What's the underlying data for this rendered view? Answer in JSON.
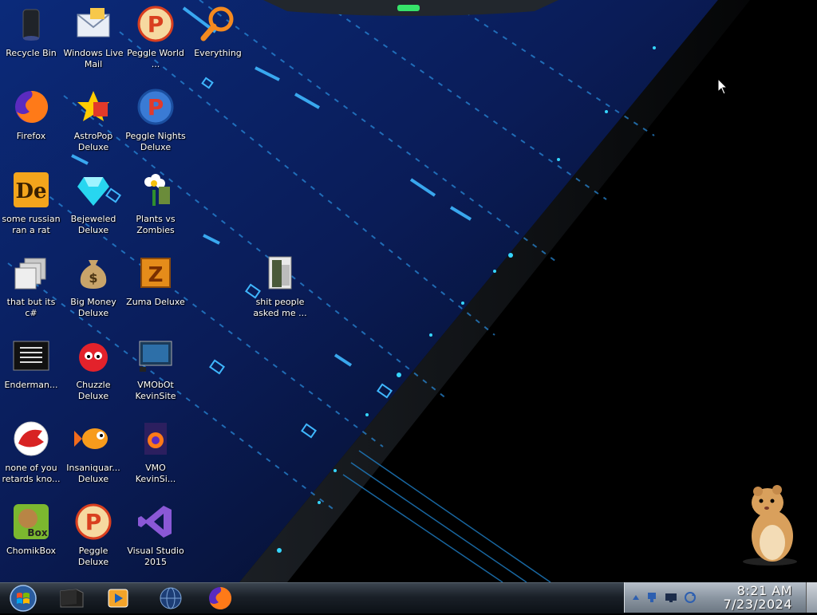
{
  "desktop": {
    "icons": [
      {
        "id": "recycle-bin",
        "label": "Recycle Bin",
        "icon": "recycle-bin-icon"
      },
      {
        "id": "windows-live-mail",
        "label": "Windows Live Mail",
        "icon": "mail-icon"
      },
      {
        "id": "peggle-world",
        "label": "Peggle World ...",
        "icon": "peggle-icon"
      },
      {
        "id": "everything",
        "label": "Everything",
        "icon": "magnifier-icon"
      },
      {
        "id": "firefox",
        "label": "Firefox",
        "icon": "firefox-icon"
      },
      {
        "id": "astropop",
        "label": "AstroPop Deluxe",
        "icon": "astropop-icon"
      },
      {
        "id": "peggle-nights",
        "label": "Peggle Nights Deluxe",
        "icon": "peggle-nights-icon"
      },
      {
        "id": "some-russian",
        "label": "some russian ran a rat",
        "icon": "de-icon"
      },
      {
        "id": "bejeweled",
        "label": "Bejeweled Deluxe",
        "icon": "gem-icon"
      },
      {
        "id": "pvz",
        "label": "Plants vs Zombies",
        "icon": "flower-icon"
      },
      {
        "id": "that-but-csharp",
        "label": "that but its c#",
        "icon": "copy-icon"
      },
      {
        "id": "big-money",
        "label": "Big Money Deluxe",
        "icon": "money-bag-icon"
      },
      {
        "id": "zuma",
        "label": "Zuma Deluxe",
        "icon": "zuma-icon"
      },
      {
        "id": "shit-people",
        "label": "shit people asked me ...",
        "icon": "folder-icon"
      },
      {
        "id": "enderman",
        "label": "Enderman...",
        "icon": "terminal-icon"
      },
      {
        "id": "chuzzle",
        "label": "Chuzzle Deluxe",
        "icon": "chuzzle-icon"
      },
      {
        "id": "vmobot",
        "label": "VMObOt KevinSite",
        "icon": "monitor-icon"
      },
      {
        "id": "none-of-you",
        "label": "none of you retards kno...",
        "icon": "red-creature-icon"
      },
      {
        "id": "insaniquarium",
        "label": "Insaniquar... Deluxe",
        "icon": "fish-icon"
      },
      {
        "id": "vmo-kevinsi",
        "label": "VMO KevinSi...",
        "icon": "firefox-file-icon"
      },
      {
        "id": "chomikbox",
        "label": "ChomikBox",
        "icon": "hamster-box-icon"
      },
      {
        "id": "peggle-deluxe",
        "label": "Peggle Deluxe",
        "icon": "peggle-icon"
      },
      {
        "id": "visual-studio",
        "label": "Visual Studio 2015",
        "icon": "visual-studio-icon"
      }
    ]
  },
  "taskbar": {
    "buttons": [
      {
        "id": "start",
        "icon": "windows-orb-icon"
      },
      {
        "id": "file-explorer",
        "icon": "folder-dark-icon"
      },
      {
        "id": "media-player",
        "icon": "media-player-icon"
      },
      {
        "id": "ie",
        "icon": "globe-icon"
      },
      {
        "id": "firefox",
        "icon": "firefox-icon"
      }
    ],
    "tray": {
      "icons": [
        "show-hidden-icon",
        "network-icon",
        "monitor-icon",
        "sync-icon"
      ],
      "time": "8:21 AM",
      "date": "7/23/2024"
    }
  },
  "colors": {
    "accent": "#2aa8ff",
    "glow": "#35d6ff",
    "taskbar": "#1a2028"
  }
}
